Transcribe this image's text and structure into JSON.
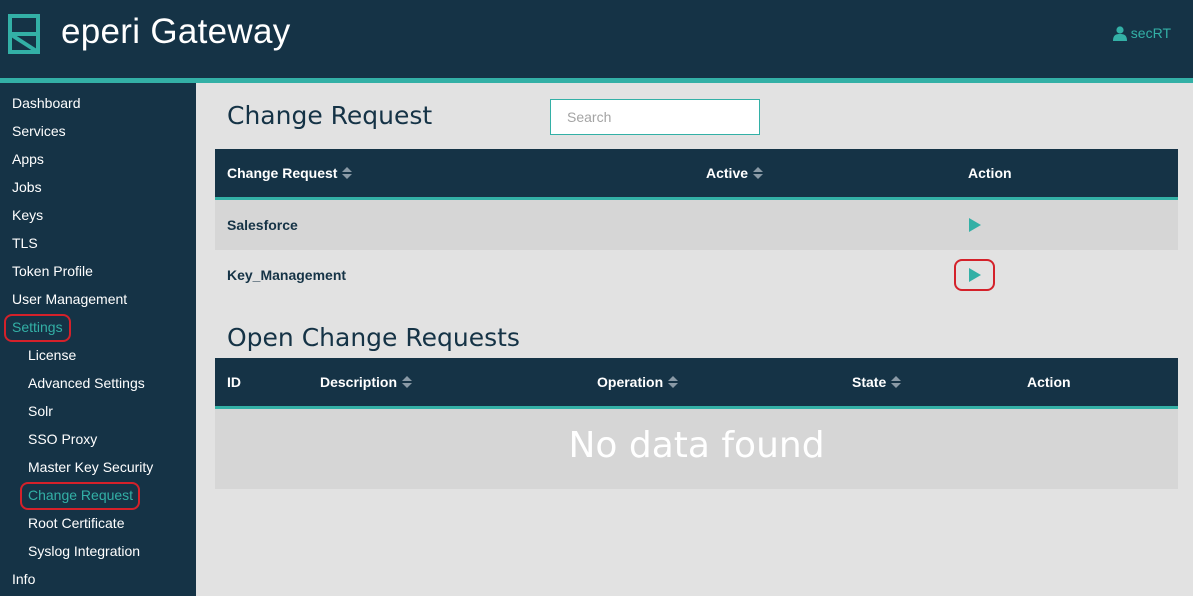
{
  "app": {
    "title": "eperi Gateway",
    "user": "secRT"
  },
  "sidebar": {
    "items": [
      {
        "label": "Dashboard"
      },
      {
        "label": "Services"
      },
      {
        "label": "Apps"
      },
      {
        "label": "Jobs"
      },
      {
        "label": "Keys"
      },
      {
        "label": "TLS"
      },
      {
        "label": "Token Profile"
      },
      {
        "label": "User Management"
      },
      {
        "label": "Settings"
      },
      {
        "label": "License"
      },
      {
        "label": "Advanced Settings"
      },
      {
        "label": "Solr"
      },
      {
        "label": "SSO Proxy"
      },
      {
        "label": "Master Key Security"
      },
      {
        "label": "Change Request"
      },
      {
        "label": "Root Certificate"
      },
      {
        "label": "Syslog Integration"
      },
      {
        "label": "Info"
      }
    ],
    "active": "Change Request"
  },
  "change_request": {
    "title": "Change Request",
    "search_placeholder": "Search",
    "columns": {
      "name": "Change Request",
      "active": "Active",
      "action": "Action"
    },
    "rows": [
      {
        "name": "Salesforce",
        "active": ""
      },
      {
        "name": "Key_Management",
        "active": ""
      }
    ]
  },
  "open_requests": {
    "title": "Open Change Requests",
    "columns": {
      "id": "ID",
      "description": "Description",
      "operation": "Operation",
      "state": "State",
      "action": "Action"
    },
    "empty_text": "No data found"
  },
  "colors": {
    "navy": "#153346",
    "teal": "#33b0a6",
    "highlight": "#d4212a"
  }
}
